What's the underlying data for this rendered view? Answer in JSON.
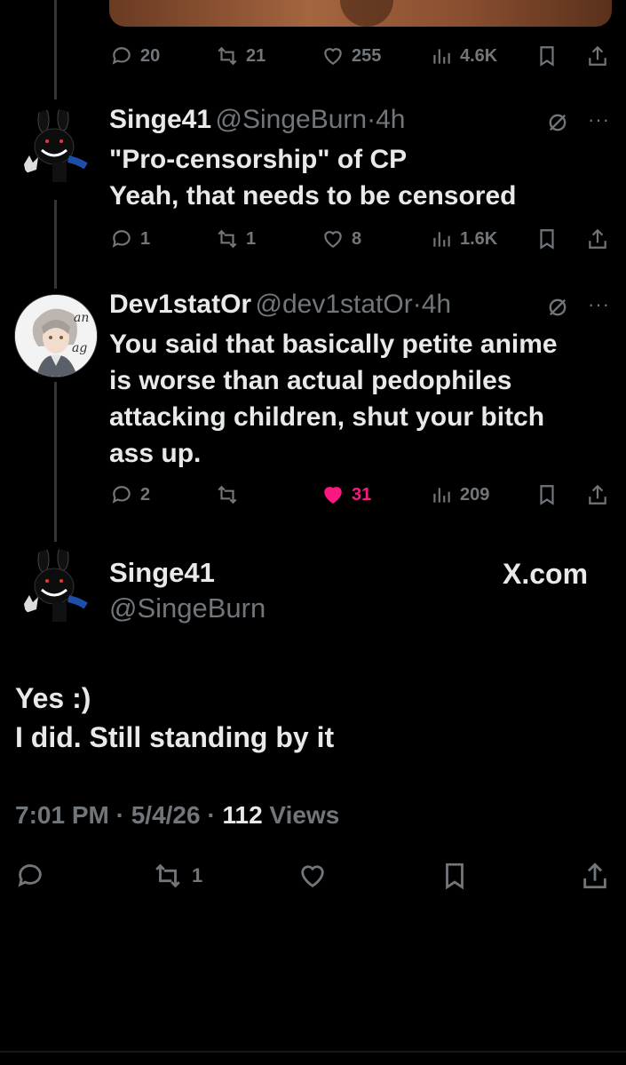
{
  "top_tweet": {
    "stats": {
      "replies": "20",
      "reposts": "21",
      "likes": "255",
      "views": "4.6K"
    }
  },
  "reply1": {
    "name": "Singe41",
    "handle": "@SingeBurn",
    "sep": "·",
    "time": "4h",
    "lines": [
      "\"Pro-censorship\" of CP",
      "Yeah, that needs to be censored"
    ],
    "stats": {
      "replies": "1",
      "reposts": "1",
      "likes": "8",
      "views": "1.6K"
    }
  },
  "reply2": {
    "name": "Dev1statOr",
    "handle": "@dev1statOr",
    "sep": "·",
    "time": "4h",
    "lines": [
      "You said that basically petite anime",
      "is worse than actual pedophiles",
      "attacking children, shut your bitch",
      "ass up."
    ],
    "stats": {
      "replies": "2",
      "reposts": "",
      "likes": "31",
      "views": "209"
    },
    "liked": true
  },
  "main_tweet": {
    "name": "Singe41",
    "handle": "@SingeBurn",
    "watermark": "X.com",
    "lines": [
      "Yes :)",
      "I did. Still standing by it"
    ],
    "time": "7:01 PM",
    "date": "5/4/26",
    "views_count": "112",
    "views_label": "Views",
    "sep": "·",
    "stats": {
      "reposts": "1"
    }
  },
  "colors": {
    "accent_like": "#f91880",
    "secondary_text": "#71767b",
    "primary_text": "#e7e9ea",
    "background": "#000000"
  }
}
